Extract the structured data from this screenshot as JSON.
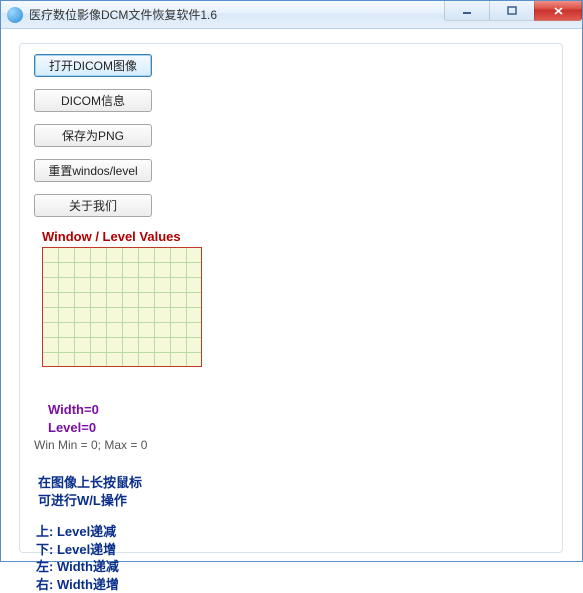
{
  "window": {
    "title": "医疗数位影像DCM文件恢复软件1.6"
  },
  "buttons": {
    "open": "打开DICOM图像",
    "info": "DICOM信息",
    "savepng": "保存为PNG",
    "reset": "重置windos/level",
    "about": "关于我们"
  },
  "wl": {
    "heading": "Window / Level Values",
    "width_label": "Width=",
    "width_value": "0",
    "level_label": "Level=",
    "level_value": "0",
    "minmax": "Win Min = 0; Max = 0"
  },
  "instructions": {
    "line1": "在图像上长按鼠标",
    "line2": " 可进行W/L操作",
    "up": "上: Level递减",
    "down": "下: Level递增",
    "left": "左: Width递减",
    "right": "右: Width递增"
  }
}
